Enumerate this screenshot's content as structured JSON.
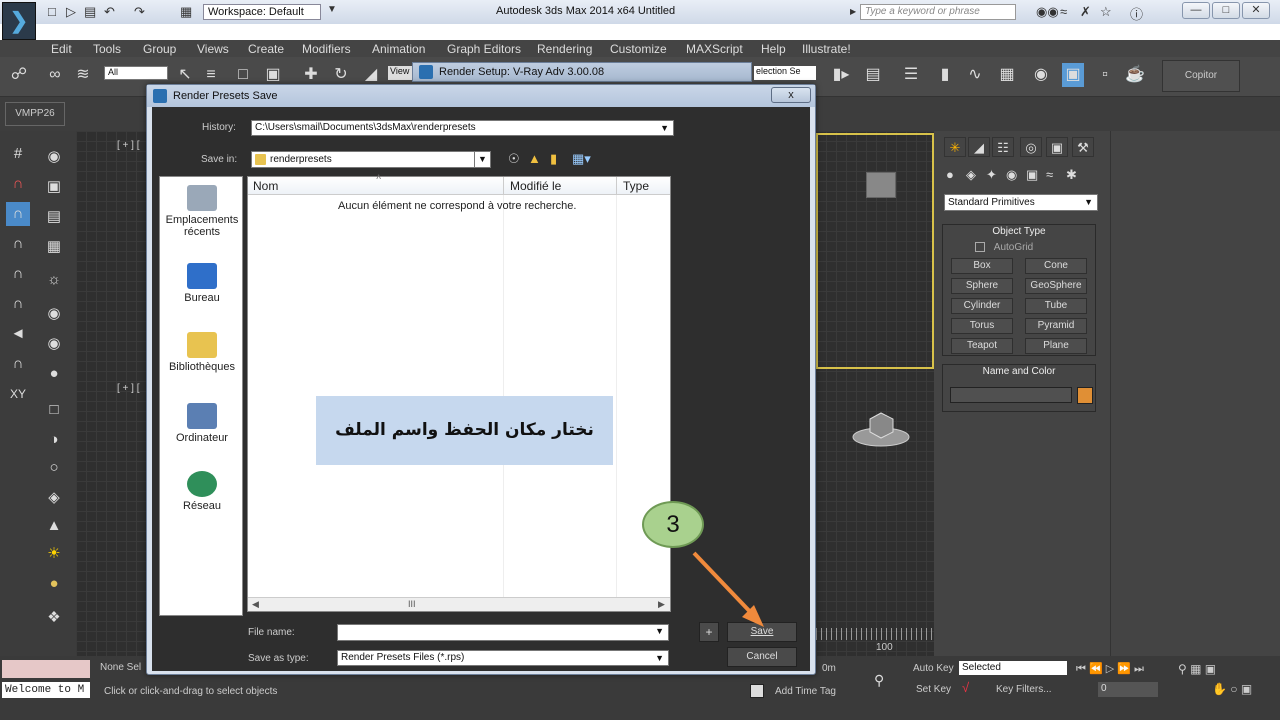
{
  "app": {
    "title": "Autodesk 3ds Max  2014 x64    Untitled",
    "workspace": "Workspace: Default",
    "search_placeholder": "Type a keyword or phrase",
    "logo_icon": "3dsmax-logo-icon"
  },
  "menu": [
    "Edit",
    "Tools",
    "Group",
    "Views",
    "Create",
    "Modifiers",
    "Animation",
    "Graph Editors",
    "Rendering",
    "Customize",
    "MAXScript",
    "Help",
    "Illustrate!"
  ],
  "toolbar": {
    "selection_filter": "All",
    "view_label": "View",
    "ref_coord": "election Se",
    "copitor": "Copitor"
  },
  "ribbon": {
    "vmpp": "VMPP26"
  },
  "viewport": {
    "label_top": "[ + ] [",
    "label_bottom": "[ + ] [",
    "timeline_end": "100"
  },
  "render_setup": {
    "title": "Render Setup: V-Ray Adv 3.00.08"
  },
  "dialog": {
    "title": "Render Presets Save",
    "history_label": "History:",
    "history_value": "C:\\Users\\smail\\Documents\\3dsMax\\renderpresets",
    "savein_label": "Save in:",
    "savein_value": "renderpresets",
    "places": [
      {
        "label": "Emplacements récents",
        "icon": "recent-places-icon"
      },
      {
        "label": "Bureau",
        "icon": "desktop-icon"
      },
      {
        "label": "Bibliothèques",
        "icon": "libraries-icon"
      },
      {
        "label": "Ordinateur",
        "icon": "computer-icon"
      },
      {
        "label": "Réseau",
        "icon": "network-icon"
      }
    ],
    "columns": [
      "Nom",
      "Modifié le",
      "Type"
    ],
    "empty_message": "Aucun élément ne correspond à votre recherche.",
    "scroll_mark": "III",
    "filename_label": "File name:",
    "filename_value": "",
    "saveas_label": "Save as type:",
    "saveas_value": "Render Presets Files (*.rps)",
    "plus_label": "+",
    "save_label": "Save",
    "cancel_label": "Cancel",
    "close_label": "x"
  },
  "annotation": {
    "text": "نختار مكان الحفظ واسم الملف",
    "step": "3",
    "arrow_color": "#f08a3c"
  },
  "command_panel": {
    "category": "Standard Primitives",
    "object_type_title": "Object Type",
    "autogrid": "AutoGrid",
    "buttons": [
      "Box",
      "Cone",
      "Sphere",
      "GeoSphere",
      "Cylinder",
      "Tube",
      "Torus",
      "Pyramid",
      "Teapot",
      "Plane"
    ],
    "name_color_title": "Name and Color",
    "object_color": "#e08f35"
  },
  "status": {
    "welcome": "Welcome to M",
    "none_selected": "None Sel",
    "prompt": "Click or click-and-drag to select objects",
    "add_time_tag": "Add Time Tag",
    "auto_key": "Auto Key",
    "set_key": "Set Key",
    "key_mode": "Selected",
    "key_filters": "Key Filters...",
    "frame": "0",
    "coord_fragment": "0m"
  }
}
